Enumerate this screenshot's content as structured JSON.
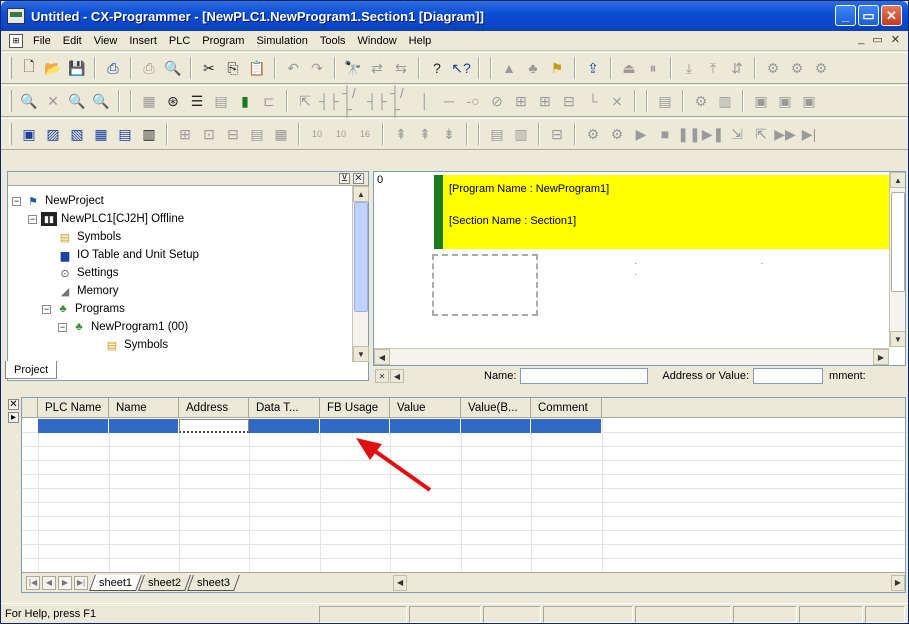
{
  "window": {
    "title": "Untitled - CX-Programmer - [NewPLC1.NewProgram1.Section1 [Diagram]]"
  },
  "menu": [
    "File",
    "Edit",
    "View",
    "Insert",
    "PLC",
    "Program",
    "Simulation",
    "Tools",
    "Window",
    "Help"
  ],
  "toolbars": {
    "row1": [
      "new-icon",
      "open-icon",
      "save-icon",
      "sep",
      "print-icon",
      "sep",
      "print-preview-icon",
      "print-settings-icon",
      "sep",
      "cut-icon",
      "copy-icon",
      "paste-icon",
      "sep",
      "undo-icon",
      "redo-icon",
      "sep",
      "find-icon",
      "replace-icon",
      "replace-all-icon",
      "sep",
      "help-icon",
      "context-help-icon",
      "sep",
      "online-icon",
      "monitor-icon",
      "compare-icon",
      "sep",
      "transfer-icon",
      "step-icon",
      "pause-icon",
      "sep",
      "toolbar-icon",
      "toolbar-icon",
      "toolbar-icon",
      "sep",
      "toolbar-icon",
      "toolbar-icon",
      "toolbar-icon"
    ],
    "row2": [
      "zoom-icon",
      "zoom-in-icon",
      "zoom-out-icon",
      "zoom-fit-icon",
      "sep",
      "grid-icon",
      "monitor-icon",
      "list-icon",
      "view-icon",
      "rung-icon",
      "comment-icon",
      "sep",
      "select-icon",
      "contact-no-icon",
      "contact-nc-icon",
      "contact-or-icon",
      "contact-ornc-icon",
      "vertical-icon",
      "horizontal-icon",
      "coil-icon",
      "coil-nc-icon",
      "instruction-icon",
      "instruction2-icon",
      "instruction3-icon",
      "line-icon",
      "delete-line-icon",
      "sep",
      "toolbar-icon",
      "sep",
      "toolbar-icon",
      "toolbar-icon",
      "sep",
      "toolbar-icon",
      "toolbar-icon",
      "toolbar-icon"
    ],
    "row3": [
      "project-window-icon",
      "output-window-icon",
      "watch-window-icon",
      "address-ref-icon",
      "io-comment-icon",
      "properties-icon",
      "sep",
      "toolbar-icon",
      "toolbar-icon",
      "toolbar-icon",
      "toolbar-icon",
      "toolbar-icon",
      "sep",
      "hex-10-icon",
      "dec-10-icon",
      "bin-16-icon",
      "sep",
      "toolbar-icon",
      "toolbar-icon",
      "toolbar-icon",
      "sep",
      "toolbar-icon",
      "toolbar-icon",
      "sep",
      "toolbar-icon",
      "sep",
      "run-icon",
      "play-icon",
      "stop-icon",
      "pause-icon",
      "step-icon",
      "step-in-icon",
      "step-out-icon",
      "fast-forward-icon",
      "step-end-icon"
    ]
  },
  "project_tree": {
    "tab_label": "Project",
    "items": [
      {
        "label": "NewProject",
        "indent": 0,
        "expander": "-",
        "icon": "project-icon"
      },
      {
        "label": "NewPLC1[CJ2H] Offline",
        "indent": 1,
        "expander": "-",
        "icon": "plc-icon"
      },
      {
        "label": "Symbols",
        "indent": 2,
        "expander": "",
        "icon": "symbols-icon"
      },
      {
        "label": "IO Table and Unit Setup",
        "indent": 2,
        "expander": "",
        "icon": "io-table-icon"
      },
      {
        "label": "Settings",
        "indent": 2,
        "expander": "",
        "icon": "settings-icon"
      },
      {
        "label": "Memory",
        "indent": 2,
        "expander": "",
        "icon": "memory-icon"
      },
      {
        "label": "Programs",
        "indent": 2,
        "expander": "-",
        "icon": "programs-icon"
      },
      {
        "label": "NewProgram1 (00)",
        "indent": 3,
        "expander": "-",
        "icon": "program-icon"
      },
      {
        "label": "Symbols",
        "indent": 4,
        "expander": "",
        "icon": "symbols-icon"
      }
    ]
  },
  "diagram": {
    "rung_number": "0",
    "program_name": "[Program Name : NewProgram1]",
    "section_name": "[Section Name : Section1]"
  },
  "info_strip": {
    "name_label": "Name:",
    "address_label": "Address or Value:",
    "comment_label": "mment:"
  },
  "symbol_table": {
    "columns": [
      "PLC Name",
      "Name",
      "Address",
      "Data T...",
      "FB Usage",
      "Value",
      "Value(B...",
      "Comment"
    ],
    "sheets": [
      "sheet1",
      "sheet2",
      "sheet3"
    ],
    "active_sheet": "sheet1"
  },
  "status_bar": {
    "text": "For Help, press F1"
  },
  "colors": {
    "title_bar": "#0b4fd6",
    "diagram_header": "#ffff00",
    "diagram_marker": "#1d7a1d",
    "selection": "#316ac5",
    "arrow": "#e01010"
  }
}
